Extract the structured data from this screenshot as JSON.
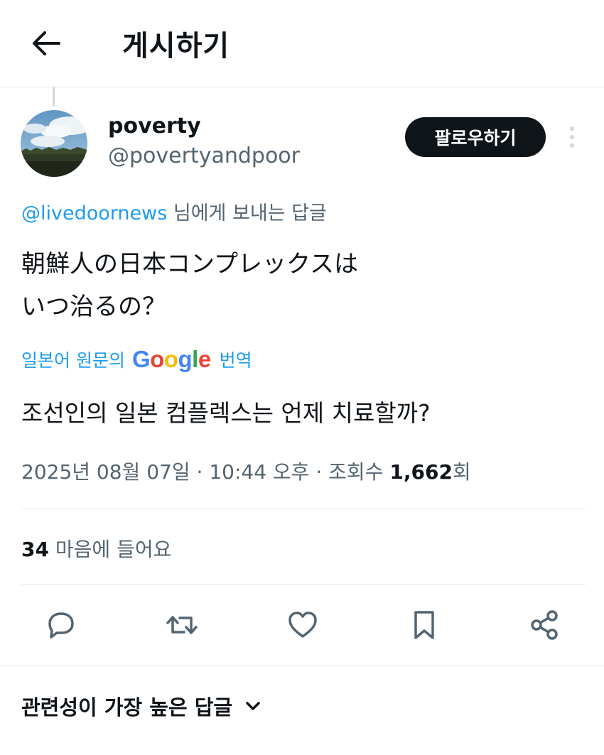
{
  "header": {
    "title": "게시하기"
  },
  "author": {
    "display_name": "poverty",
    "handle": "@povertyandpoor",
    "follow_label": "팔로우하기"
  },
  "reply_to": {
    "mention": "@livedoornews",
    "suffix": "님에게 보내는 답글"
  },
  "tweet": {
    "lines": [
      "朝鮮人の日本コンプレックスは",
      "いつ治るの？"
    ]
  },
  "translation": {
    "prefix": "일본어 원문의",
    "logo_text": "Google",
    "suffix": "번역",
    "translated_text": "조선인의 일본 컴플렉스는 언제 치료할까?"
  },
  "meta": {
    "date": "2025년 08월 07일",
    "time": "10:44 오후",
    "views_label": "조회수",
    "views_count": "1,662",
    "views_suffix": "회",
    "separator": "·"
  },
  "likes": {
    "count": "34",
    "label": "마음에 들어요"
  },
  "actions": [
    {
      "name": "reply",
      "icon": "reply-icon"
    },
    {
      "name": "repost",
      "icon": "repost-icon"
    },
    {
      "name": "like",
      "icon": "heart-icon"
    },
    {
      "name": "bookmark",
      "icon": "bookmark-icon"
    },
    {
      "name": "share",
      "icon": "share-icon"
    }
  ],
  "sort": {
    "label": "관련성이 가장 높은 답글"
  },
  "colors": {
    "text": "#0f1419",
    "secondary": "#536471",
    "link": "#1d9bf0",
    "divider": "#e6e9ec",
    "google_blue": "#4285F4",
    "google_red": "#EA4335",
    "google_yellow": "#FBBC05",
    "google_green": "#34A853"
  }
}
